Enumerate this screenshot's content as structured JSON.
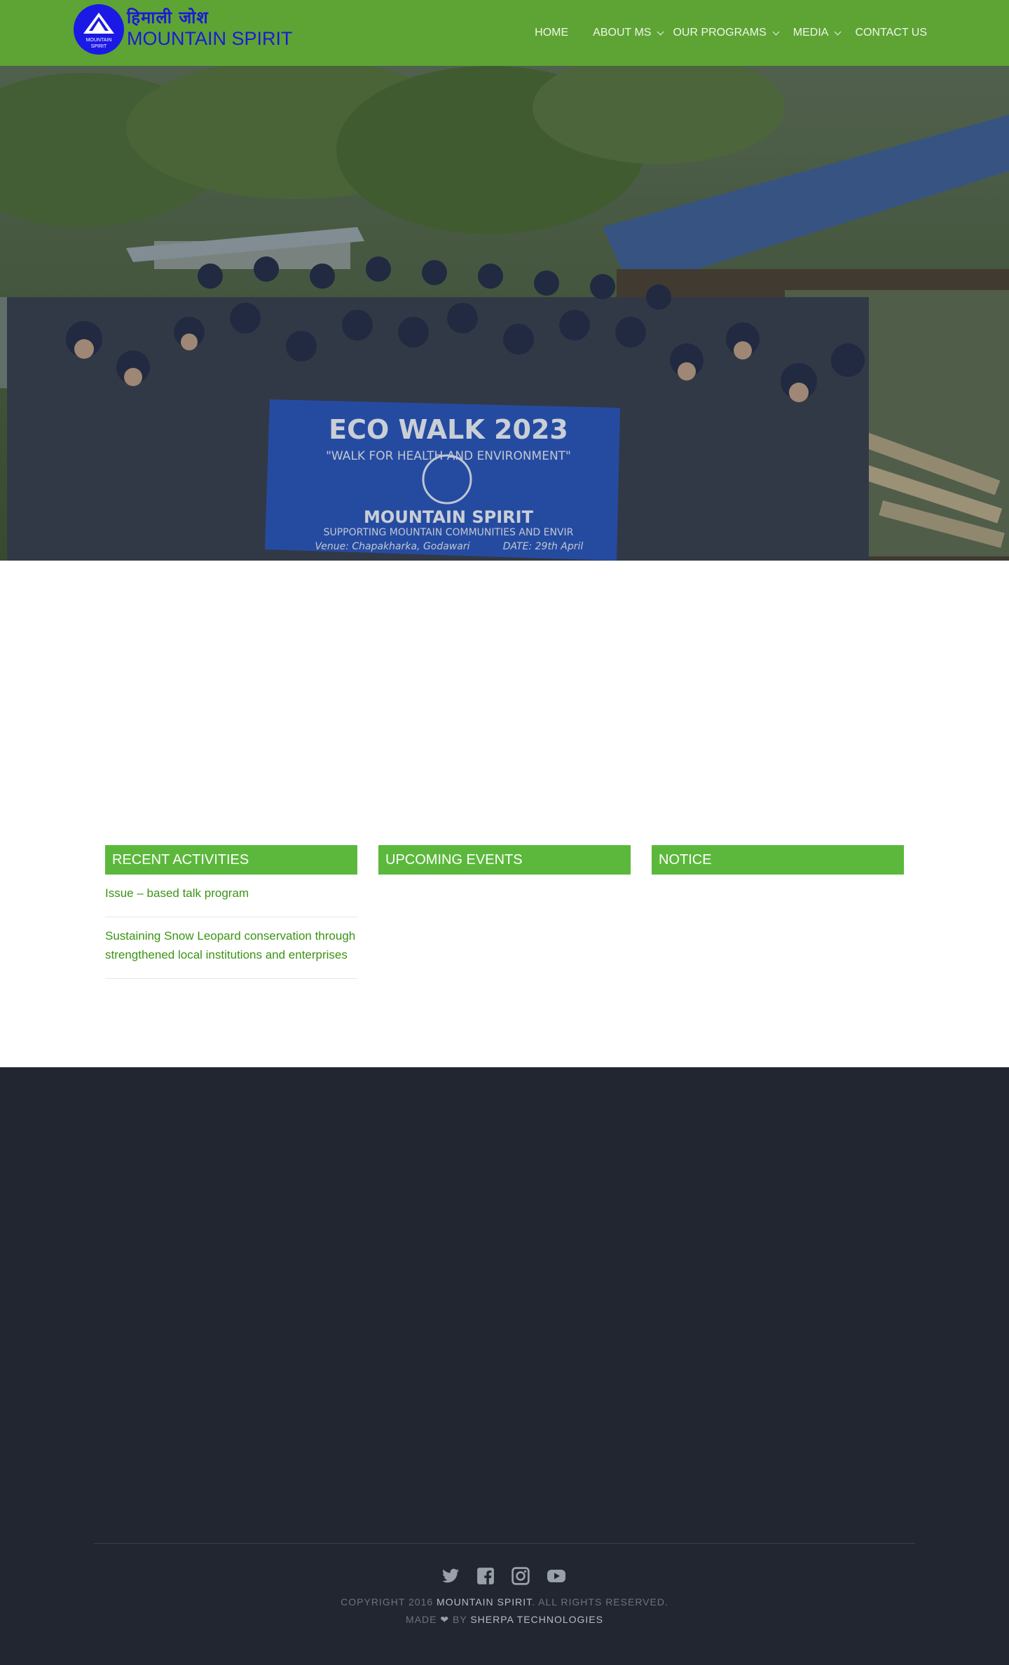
{
  "brand": {
    "name_devanagari": "हिमाली जोश",
    "name_english": "MOUNTAIN SPIRIT",
    "badge_line1": "MOUNTAIN",
    "badge_line2": "SPIRIT",
    "color_primary": "#5da434",
    "color_logo": "#1a1ad6"
  },
  "nav": {
    "items": [
      {
        "label": "HOME",
        "has_dropdown": false
      },
      {
        "label": "ABOUT MS",
        "has_dropdown": true
      },
      {
        "label": "OUR PROGRAMS",
        "has_dropdown": true
      },
      {
        "label": "MEDIA",
        "has_dropdown": true
      },
      {
        "label": "CONTACT US",
        "has_dropdown": false
      }
    ]
  },
  "hero": {
    "banner_title": "ECO WALK 2023",
    "banner_subtitle": "\"WALK FOR HEALTH AND ENVIRONMENT\"",
    "banner_org": "MOUNTAIN SPIRIT",
    "banner_tagline": "SUPPORTING MOUNTAIN COMMUNITIES AND ENVIR",
    "banner_venue": "Venue: Chapakharka, Godawari",
    "banner_date": "DATE: 29th April"
  },
  "widgets": {
    "recent": {
      "title": "RECENT ACTIVITIES",
      "items": [
        "Issue – based talk program",
        "Sustaining Snow Leopard conservation through strengthened local institutions and enterprises"
      ]
    },
    "upcoming": {
      "title": "UPCOMING EVENTS"
    },
    "notice": {
      "title": "NOTICE"
    }
  },
  "footer": {
    "socials": [
      "twitter-icon",
      "facebook-icon",
      "instagram-icon",
      "youtube-icon"
    ],
    "copyright_prefix": "COPYRIGHT 2016",
    "copyright_brand": "MOUNTAIN SPIRIT",
    "copyright_suffix": ". ALL RIGHTS RESERVED.",
    "made_prefix": "MADE",
    "made_by": "BY",
    "made_company": "SHERPA TECHNOLOGIES"
  }
}
